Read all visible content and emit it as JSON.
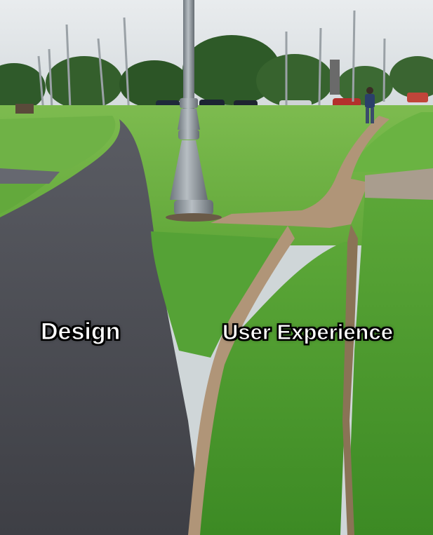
{
  "captions": {
    "design": "Design",
    "user_experience": "User Experience"
  },
  "colors": {
    "sky": "#dfe4e6",
    "grass": "#5fa83a",
    "grass_dark": "#3f8a27",
    "asphalt": "#4b4c52",
    "dirt": "#b09578",
    "lamp_post": "#8e979e"
  }
}
